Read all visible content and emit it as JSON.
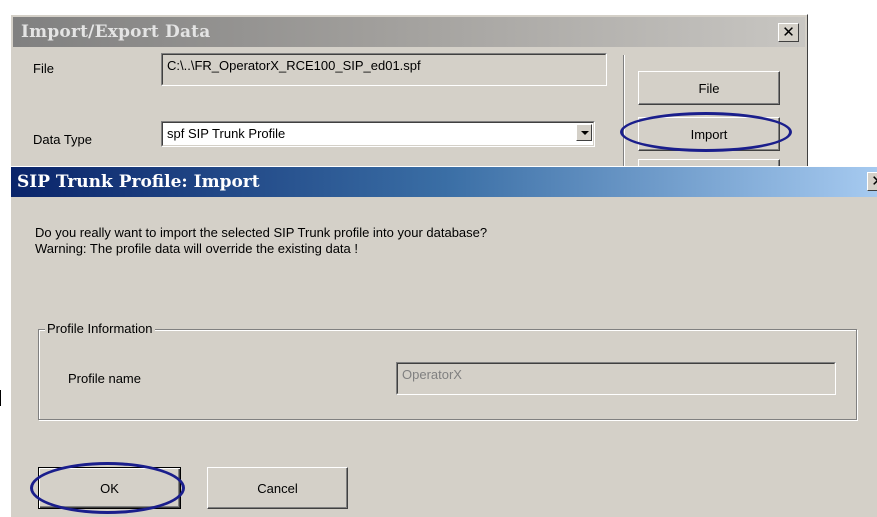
{
  "background_window": {
    "title": "Import/Export Data",
    "close_glyph": "✕",
    "file_label": "File",
    "file_value": "C:\\..\\FR_OperatorX_RCE100_SIP_ed01.spf",
    "data_type_label": "Data Type",
    "data_type_value": "spf  SIP Trunk Profile",
    "file_button": "File",
    "import_button": "Import"
  },
  "dialog": {
    "title": "SIP Trunk Profile: Import",
    "close_glyph": "✕",
    "message_line1": "Do you really want to import the selected SIP Trunk profile into your database?",
    "message_line2": "Warning: The profile data will override the existing data !",
    "group_label": "Profile Information",
    "profile_name_label": "Profile name",
    "profile_name_value": "OperatorX",
    "ok_button": "OK",
    "cancel_button": "Cancel"
  },
  "colors": {
    "highlight_ellipse": "#1a1e8c",
    "dialog_title_gradient_start": "#0a246a",
    "inactive_title_gradient": "#808080",
    "face": "#d4d0c8"
  }
}
